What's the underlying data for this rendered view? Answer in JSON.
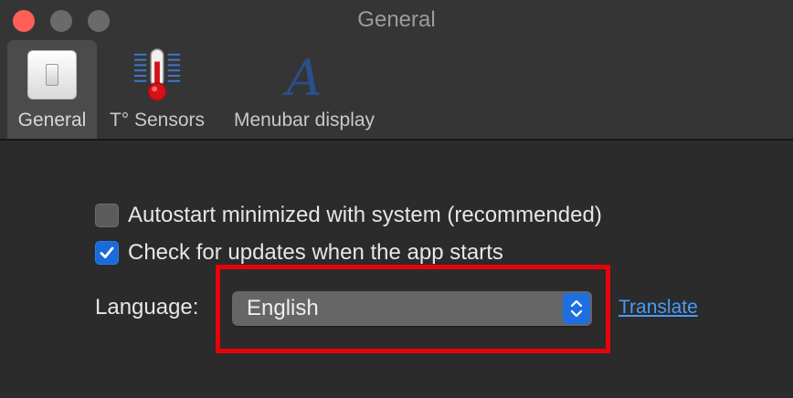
{
  "window": {
    "title": "General"
  },
  "toolbar": {
    "tabs": [
      {
        "label": "General",
        "icon": "light-switch-icon",
        "selected": true
      },
      {
        "label": "T° Sensors",
        "icon": "thermometer-icon",
        "selected": false
      },
      {
        "label": "Menubar display",
        "icon": "letter-a-icon",
        "selected": false
      }
    ]
  },
  "options": {
    "autostart": {
      "label": "Autostart minimized with system (recommended)",
      "checked": false
    },
    "check_updates": {
      "label": "Check for updates when the app starts",
      "checked": true
    }
  },
  "language": {
    "label": "Language:",
    "selected": "English",
    "translate_link": "Translate"
  },
  "colors": {
    "accent": "#1f6fe0",
    "highlight": "#e8000b",
    "link": "#4a9bf6",
    "close": "#fe5f57"
  }
}
